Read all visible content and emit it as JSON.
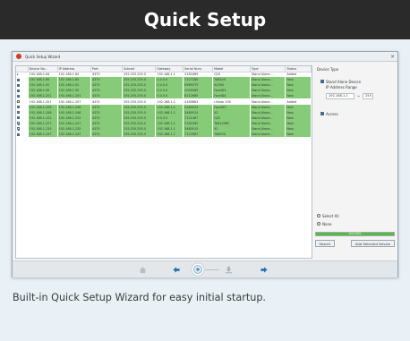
{
  "banner": {
    "title": "Quick Setup"
  },
  "window": {
    "title": "Quick Setup Wizard",
    "close_glyph": "×"
  },
  "table": {
    "headers": [
      "",
      "Device Na...",
      "IP Address",
      "Port",
      "Subnet",
      "Gateway",
      "Serial Num.",
      "Model",
      "Type",
      "Status"
    ],
    "rows": [
      {
        "checked": false,
        "marker": "▸",
        "name": "192.168.1.64",
        "ip": "192.168.1.64",
        "port": "4370",
        "subnet": "255.255.255.0",
        "gateway": "192.168.1.1",
        "serial": "3181689",
        "model": "Q20",
        "type": "Stand Alone...",
        "status": "Added",
        "style": "added"
      },
      {
        "checked": true,
        "marker": "",
        "name": "192.168.1.65",
        "ip": "192.168.1.65",
        "port": "4370",
        "subnet": "255.255.255.0",
        "gateway": "0.0.0.0",
        "serial": "7127280",
        "model": "TA8200",
        "type": "Stand Alone...",
        "status": "New",
        "style": "new"
      },
      {
        "checked": true,
        "marker": "",
        "name": "192.168.1.92",
        "ip": "192.168.1.92",
        "port": "4370",
        "subnet": "255.255.255.0",
        "gateway": "0.0.0.0",
        "serial": "6989375",
        "model": "AC900",
        "type": "Stand Alone...",
        "status": "New",
        "style": "new"
      },
      {
        "checked": true,
        "marker": "",
        "name": "192.168.1.99",
        "ip": "192.168.1.99",
        "port": "4370",
        "subnet": "255.255.255.0",
        "gateway": "0.0.0.0",
        "serial": "1035569",
        "model": "FaceID3",
        "type": "Stand Alone...",
        "status": "New",
        "style": "new"
      },
      {
        "checked": true,
        "marker": "",
        "name": "192.168.1.201",
        "ip": "192.168.1.201",
        "port": "4370",
        "subnet": "255.255.255.0",
        "gateway": "0.0.0.0",
        "serial": "6212685",
        "model": "FaceID4",
        "type": "Stand Alone...",
        "status": "New",
        "style": "new"
      },
      {
        "checked": false,
        "marker": "",
        "name": "192.168.1.207",
        "ip": "192.168.1.207",
        "port": "4370",
        "subnet": "255.255.255.0",
        "gateway": "192.168.1.1",
        "serial": "4169883",
        "model": "i-Kiosk 100",
        "type": "Stand Alone...",
        "status": "Added",
        "style": "added"
      },
      {
        "checked": true,
        "marker": "",
        "name": "192.168.1.206",
        "ip": "192.168.1.206",
        "port": "4370",
        "subnet": "255.255.255.0",
        "gateway": "192.168.1.1",
        "serial": "2280024",
        "model": "FaceID3",
        "type": "Stand Alone...",
        "status": "New",
        "style": "new"
      },
      {
        "checked": true,
        "marker": "",
        "name": "192.168.1.208",
        "ip": "192.168.1.208",
        "port": "4370",
        "subnet": "255.255.255.0",
        "gateway": "192.168.1.1",
        "serial": "3480515",
        "model": "X2",
        "type": "Stand Alone...",
        "status": "New",
        "style": "new"
      },
      {
        "checked": true,
        "marker": "",
        "name": "192.168.1.222",
        "ip": "192.168.1.222",
        "port": "4370",
        "subnet": "255.255.255.0",
        "gateway": "0.0.0.0",
        "serial": "7121487",
        "model": "Q20",
        "type": "Stand Alone...",
        "status": "New",
        "style": "new"
      },
      {
        "checked": true,
        "marker": "",
        "name": "192.168.1.227",
        "ip": "192.168.1.227",
        "port": "4370",
        "subnet": "255.255.255.0",
        "gateway": "192.168.1.1",
        "serial": "3181965",
        "model": "TA8100RC",
        "type": "Stand Alone...",
        "status": "New",
        "style": "new"
      },
      {
        "checked": true,
        "marker": "",
        "name": "192.168.1.235",
        "ip": "192.168.1.235",
        "port": "4370",
        "subnet": "255.255.255.0",
        "gateway": "192.168.1.1",
        "serial": "3480515",
        "model": "X2",
        "type": "Stand Alone...",
        "status": "New",
        "style": "new"
      },
      {
        "checked": true,
        "marker": "",
        "name": "192.168.1.247",
        "ip": "192.168.1.247",
        "port": "4370",
        "subnet": "255.255.255.0",
        "gateway": "192.168.1.1",
        "serial": "7123987",
        "model": "TA8200",
        "type": "Stand Alone...",
        "status": "New",
        "style": "new"
      }
    ]
  },
  "side_panel": {
    "device_type_label": "Device Type",
    "standalone_label": "Stand Alone Device",
    "ip_range_label": "IP Address Range",
    "ip_from": "192.168.1.1",
    "ip_separator": "~",
    "ip_to": "255",
    "access_label": "Access",
    "select_all_label": "Select All",
    "none_label": "None",
    "progress_percent": 100,
    "progress_text": "100.00%",
    "search_button": "Search",
    "add_button": "Add Selected Device"
  },
  "navbar": {
    "icons": [
      "home-icon",
      "back-arrow-icon",
      "search-device-icon",
      "download-icon",
      "forward-arrow-icon"
    ]
  },
  "caption": "Built-in Quick Setup Wizard for easy initial startup.",
  "colors": {
    "banner_bg": "#2a2a2a",
    "card_bg": "#e9f1f6",
    "row_new": "#86cc78",
    "progress": "#55b84a",
    "nav_arrow": "#2b6fb3"
  }
}
